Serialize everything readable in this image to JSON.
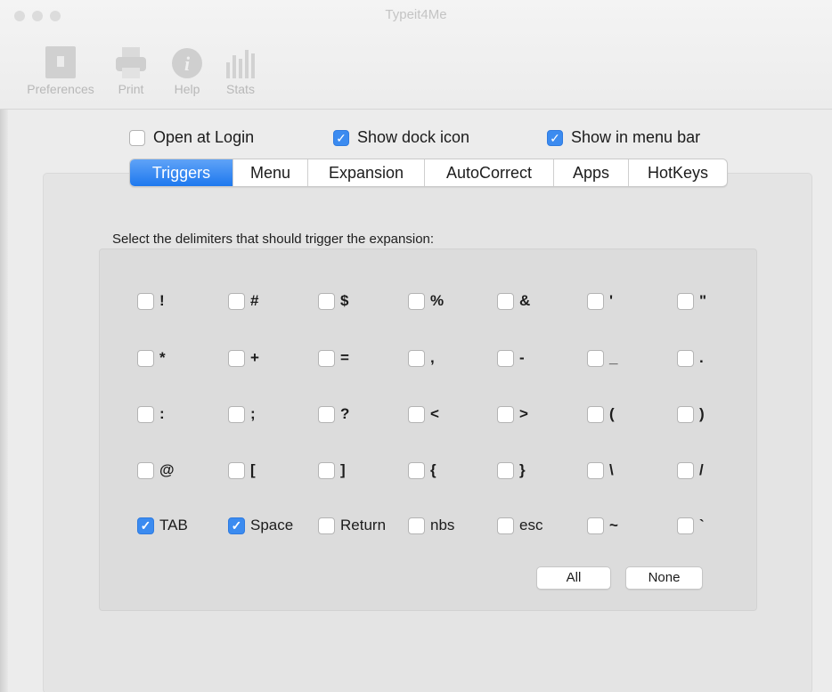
{
  "window": {
    "title": "Typeit4Me"
  },
  "toolbar": {
    "items": [
      {
        "label": "Preferences",
        "icon": "preferences-icon"
      },
      {
        "label": "Print",
        "icon": "print-icon"
      },
      {
        "label": "Help",
        "icon": "help-icon"
      },
      {
        "label": "Stats",
        "icon": "stats-icon"
      }
    ]
  },
  "options": {
    "open_at_login": {
      "label": "Open at Login",
      "checked": false
    },
    "show_dock_icon": {
      "label": "Show dock icon",
      "checked": true
    },
    "show_in_menu_bar": {
      "label": "Show in menu bar",
      "checked": true
    }
  },
  "tabs": [
    {
      "label": "Triggers",
      "active": true
    },
    {
      "label": "Menu",
      "active": false
    },
    {
      "label": "Expansion",
      "active": false
    },
    {
      "label": "AutoCorrect",
      "active": false
    },
    {
      "label": "Apps",
      "active": false
    },
    {
      "label": "HotKeys",
      "active": false
    }
  ],
  "triggers": {
    "instruction": "Select the delimiters that should trigger the expansion:",
    "rows": [
      [
        {
          "label": "!",
          "checked": false
        },
        {
          "label": "#",
          "checked": false
        },
        {
          "label": "$",
          "checked": false
        },
        {
          "label": "%",
          "checked": false
        },
        {
          "label": "&",
          "checked": false
        },
        {
          "label": "'",
          "checked": false
        },
        {
          "label": "\"",
          "checked": false
        }
      ],
      [
        {
          "label": "*",
          "checked": false
        },
        {
          "label": "+",
          "checked": false
        },
        {
          "label": "=",
          "checked": false
        },
        {
          "label": ",",
          "checked": false
        },
        {
          "label": "-",
          "checked": false
        },
        {
          "label": "_",
          "checked": false
        },
        {
          "label": ".",
          "checked": false
        }
      ],
      [
        {
          "label": ":",
          "checked": false
        },
        {
          "label": ";",
          "checked": false
        },
        {
          "label": "?",
          "checked": false
        },
        {
          "label": "<",
          "checked": false
        },
        {
          "label": ">",
          "checked": false
        },
        {
          "label": "(",
          "checked": false
        },
        {
          "label": ")",
          "checked": false
        }
      ],
      [
        {
          "label": "@",
          "checked": false
        },
        {
          "label": "[",
          "checked": false
        },
        {
          "label": "]",
          "checked": false
        },
        {
          "label": "{",
          "checked": false
        },
        {
          "label": "}",
          "checked": false
        },
        {
          "label": "\\",
          "checked": false
        },
        {
          "label": "/",
          "checked": false
        }
      ],
      [
        {
          "label": "TAB",
          "checked": true
        },
        {
          "label": "Space",
          "checked": true
        },
        {
          "label": "Return",
          "checked": false
        },
        {
          "label": "nbs",
          "checked": false
        },
        {
          "label": "esc",
          "checked": false
        },
        {
          "label": "~",
          "checked": false
        },
        {
          "label": "`",
          "checked": false
        }
      ]
    ],
    "all_button": "All",
    "none_button": "None"
  },
  "colors": {
    "accent": "#3b8bf0",
    "tab_active": "#1e78ee"
  }
}
